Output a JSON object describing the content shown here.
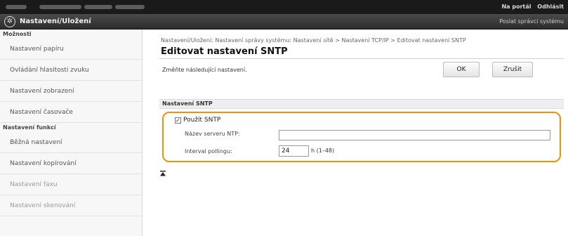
{
  "topbar": {
    "portal_link": "Na portál",
    "logout_link": "Odhlásit"
  },
  "header": {
    "title": "Nastavení/Uložení",
    "admin_link": "Poslat správci systému",
    "logo_icon": "settings-gear-icon"
  },
  "sidebar": {
    "section1": "Možnosti",
    "items1": [
      "Nastavení papíru",
      "Ovládání hlasitosti zvuku",
      "Nastavení zobrazení",
      "Nastavení časovače"
    ],
    "section2": "Nastavení funkcí",
    "items2": [
      "Běžná nastavení",
      "Nastavení kopírování",
      "Nastavení faxu",
      "Nastavení skenování"
    ]
  },
  "main": {
    "breadcrumb": "Nastavení/Uložení: Nastavení správy systému: Nastavení sítě > Nastavení TCP/IP > Editovat nastavení SNTP",
    "title": "Editovat nastavení SNTP",
    "instruction": "Změňte následující nastavení.",
    "ok_label": "OK",
    "cancel_label": "Zrušit",
    "section_label": "Nastavení SNTP",
    "use_sntp_label": "Použít SNTP",
    "use_sntp_checked": true,
    "ntp_server_label": "Název serveru NTP:",
    "ntp_server_value": "",
    "polling_label": "Interval pollingu:",
    "polling_value": "24",
    "polling_range": "h (1–48)",
    "highlight_color": "#f39200"
  }
}
